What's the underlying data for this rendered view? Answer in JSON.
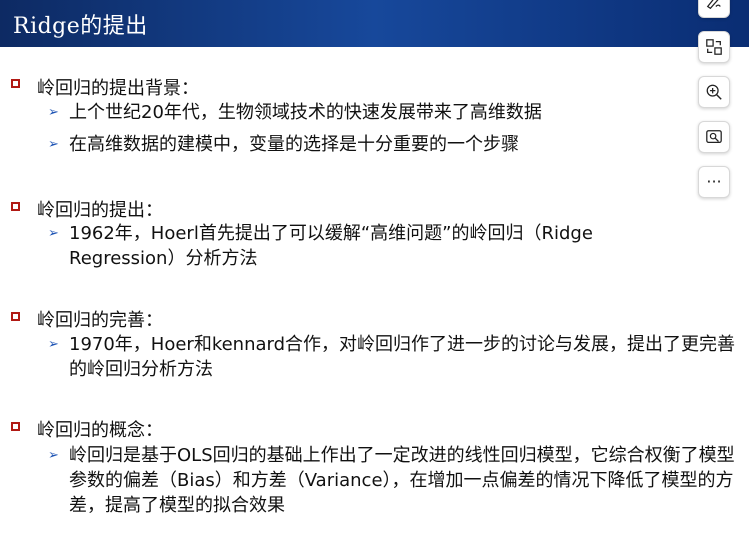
{
  "slide": {
    "title": "Ridge的提出"
  },
  "sections": [
    {
      "heading": "岭回归的提出背景：",
      "bullets": [
        "上个世纪20年代，生物领域技术的快速发展带来了高维数据",
        "在高维数据的建模中，变量的选择是十分重要的一个步骤"
      ]
    },
    {
      "heading": "岭回归的提出：",
      "bullets": [
        "1962年，Hoerl首先提出了可以缓解“高维问题”的岭回归（Ridge Regression）分析方法"
      ]
    },
    {
      "heading": "岭回归的完善：",
      "bullets": [
        "1970年，Hoer和kennard合作，对岭回归作了进一步的讨论与发展，提出了更完善的岭回归分析方法"
      ]
    },
    {
      "heading": "岭回归的概念：",
      "bullets": [
        "岭回归是基于OLS回归的基础上作出了一定改进的线性回归模型，它综合权衡了模型参数的偏差（Bias）和方差（Variance），在增加一点偏差的情况下降低了模型的方差，提高了模型的拟合效果"
      ]
    }
  ],
  "toolbar": {
    "icons": [
      "draw-icon",
      "translate-icon",
      "zoom-in-icon",
      "screenshot-icon",
      "more-icon"
    ],
    "more_label": "···"
  }
}
